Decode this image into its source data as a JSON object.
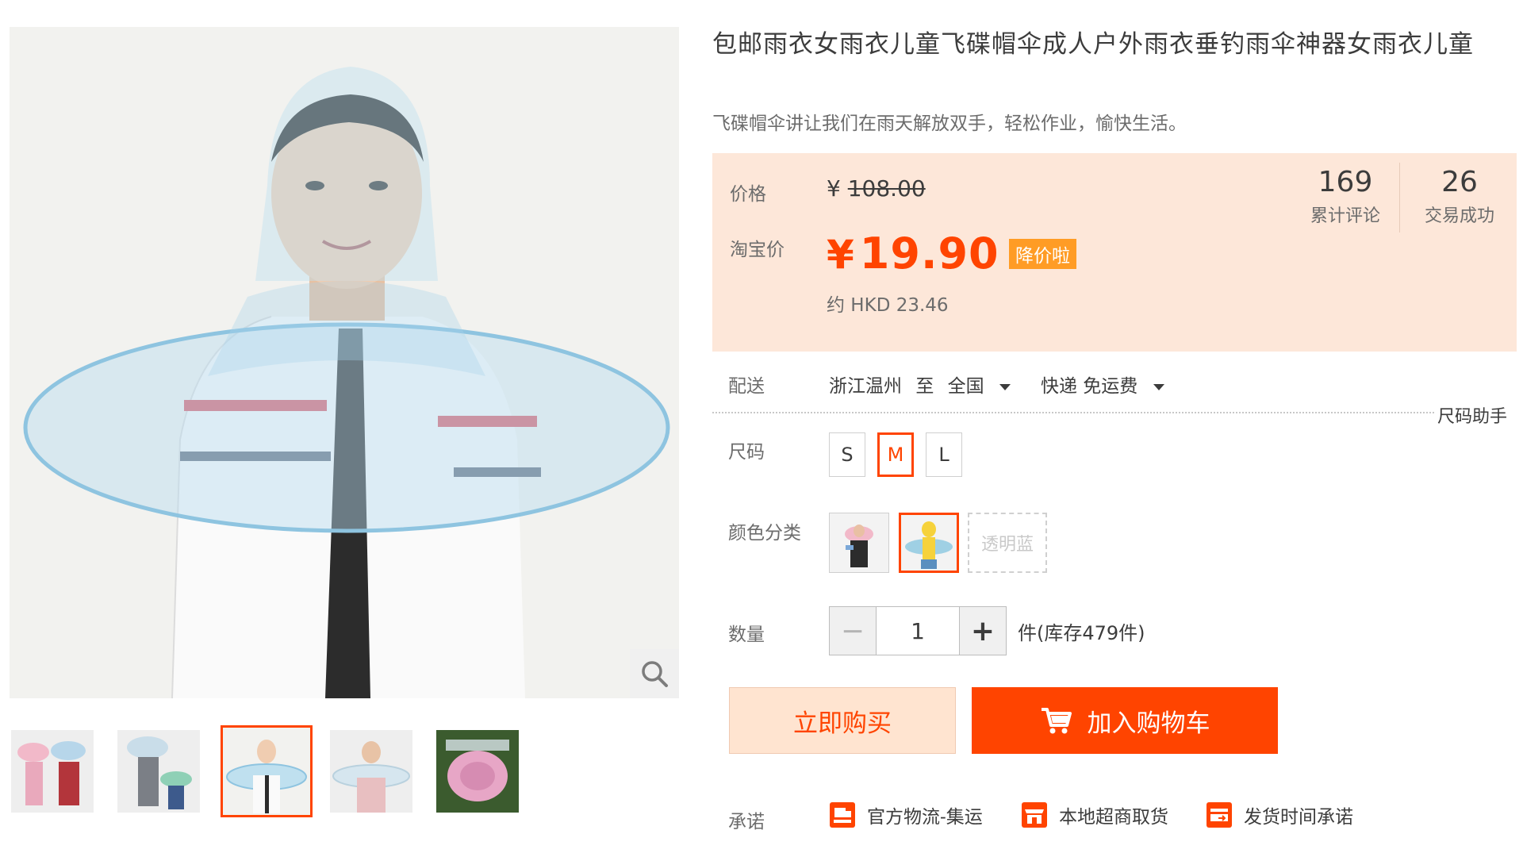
{
  "title": "包邮雨衣女雨衣儿童飞碟帽伞成人户外雨衣垂钓雨伞神器女雨衣儿童",
  "subtitle": "飞碟帽伞讲让我们在雨天解放双手，轻松作业，愉快生活。",
  "price": {
    "label": "价格",
    "currency": "¥",
    "original": "108.00",
    "taobao_label": "淘宝价",
    "current": "19.90",
    "promo_tag": "降价啦",
    "hkd": "约 HKD 23.46",
    "colors": {
      "accent": "#ff4400",
      "promo": "#ff9c25",
      "box_bg": "#fde7d9"
    }
  },
  "stats": [
    {
      "value": "169",
      "label": "累计评论"
    },
    {
      "value": "26",
      "label": "交易成功"
    }
  ],
  "shipping": {
    "label": "配送",
    "origin": "浙江温州",
    "to": "至",
    "dest": "全国",
    "method": "快递 免运费"
  },
  "size_helper": "尺码助手",
  "size": {
    "label": "尺码",
    "options": [
      "S",
      "M",
      "L"
    ],
    "selected": "M"
  },
  "color": {
    "label": "颜色分类",
    "text_option": "透明蓝"
  },
  "quantity": {
    "label": "数量",
    "value": "1",
    "minus": "−",
    "plus": "+",
    "stock": "件(库存479件)"
  },
  "buttons": {
    "buy_now": "立即购买",
    "add_cart": "加入购物车"
  },
  "promise": {
    "label": "承诺",
    "items": [
      "官方物流-集运",
      "本地超商取货",
      "发货时间承诺"
    ]
  },
  "icons": {
    "zoom": "magnifier-icon",
    "cart": "cart-icon",
    "caret": "caret-down-icon"
  }
}
